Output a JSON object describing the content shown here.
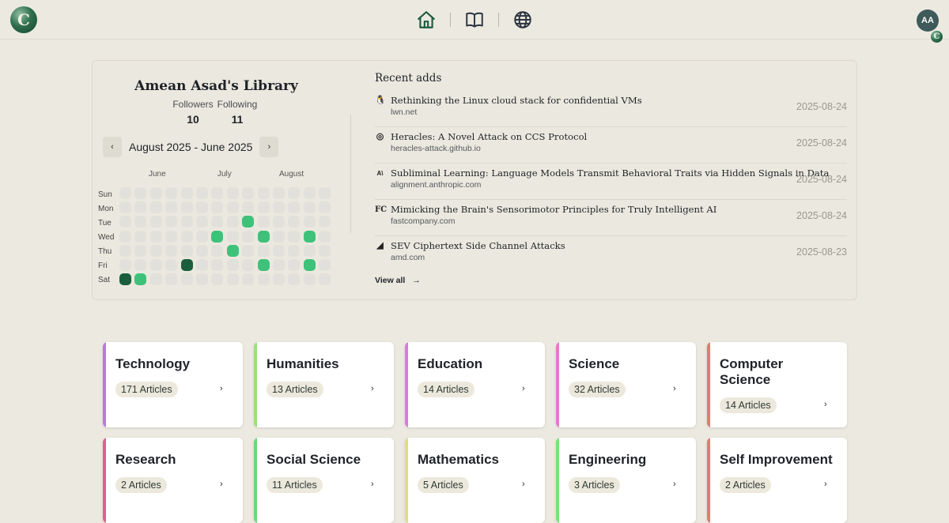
{
  "app": {
    "logo_letter": "C",
    "avatar_initials": "AA",
    "avatar_badge_letter": "C",
    "nav_icons": [
      "home-icon",
      "book-icon",
      "globe-icon"
    ],
    "accent": "#1f5c3f"
  },
  "library": {
    "title": "Amean Asad's Library",
    "followers_label": "Followers",
    "followers_count": "10",
    "following_label": "Following",
    "following_count": "11"
  },
  "calendar": {
    "range": "August 2025 - June 2025",
    "prev": "‹",
    "next": "›",
    "months": [
      "June",
      "July",
      "August"
    ],
    "days": [
      "Sun",
      "Mon",
      "Tue",
      "Wed",
      "Thu",
      "Fri",
      "Sat"
    ],
    "weeks": 14,
    "last_week_days": 7,
    "colors": {
      "empty": "#e2e0da",
      "light": "#3ec27a",
      "dark": "#1b5e3d"
    },
    "active_cells": [
      {
        "week": 0,
        "day": 6,
        "level": "dark"
      },
      {
        "week": 1,
        "day": 6,
        "level": "light"
      },
      {
        "week": 4,
        "day": 5,
        "level": "dark"
      },
      {
        "week": 6,
        "day": 3,
        "level": "light"
      },
      {
        "week": 7,
        "day": 4,
        "level": "light"
      },
      {
        "week": 8,
        "day": 2,
        "level": "light"
      },
      {
        "week": 9,
        "day": 3,
        "level": "light"
      },
      {
        "week": 9,
        "day": 5,
        "level": "light"
      },
      {
        "week": 12,
        "day": 3,
        "level": "light"
      },
      {
        "week": 12,
        "day": 5,
        "level": "light"
      }
    ],
    "last_week_len": 7
  },
  "recent": {
    "title": "Recent adds",
    "view_all": "View all",
    "items": [
      {
        "favicon": "🐧",
        "title": "Rethinking the Linux cloud stack for confidential VMs",
        "domain": "lwn.net",
        "date": "2025-08-24"
      },
      {
        "favicon": "◎",
        "title": "Heracles: A Novel Attack on CCS Protocol",
        "domain": "heracles-attack.github.io",
        "date": "2025-08-24"
      },
      {
        "favicon": "A\\",
        "title": "Subliminal Learning: Language Models Transmit Behavioral Traits via Hidden Signals in Data",
        "domain": "alignment.anthropic.com",
        "date": "2025-08-24"
      },
      {
        "favicon": "FC",
        "title": "Mimicking the Brain's Sensorimotor Principles for Truly Intelligent AI",
        "domain": "fastcompany.com",
        "date": "2025-08-24"
      },
      {
        "favicon": "◢",
        "title": "SEV Ciphertext Side Channel Attacks",
        "domain": "amd.com",
        "date": "2025-08-23"
      }
    ]
  },
  "categories": [
    {
      "name": "Technology",
      "count": "171 Articles",
      "color": "#b57be0"
    },
    {
      "name": "Humanities",
      "count": "13 Articles",
      "color": "#9be07b"
    },
    {
      "name": "Education",
      "count": "14 Articles",
      "color": "#d87be0"
    },
    {
      "name": "Science",
      "count": "32 Articles",
      "color": "#e07bc9"
    },
    {
      "name": "Computer Science",
      "count": "14 Articles",
      "color": "#e07b6e"
    },
    {
      "name": "Research",
      "count": "2 Articles",
      "color": "#e0608f"
    },
    {
      "name": "Social Science",
      "count": "11 Articles",
      "color": "#6fd67b"
    },
    {
      "name": "Mathematics",
      "count": "5 Articles",
      "color": "#e0e07b"
    },
    {
      "name": "Engineering",
      "count": "3 Articles",
      "color": "#7be07b"
    },
    {
      "name": "Self Improvement",
      "count": "2 Articles",
      "color": "#e07b6e"
    }
  ]
}
